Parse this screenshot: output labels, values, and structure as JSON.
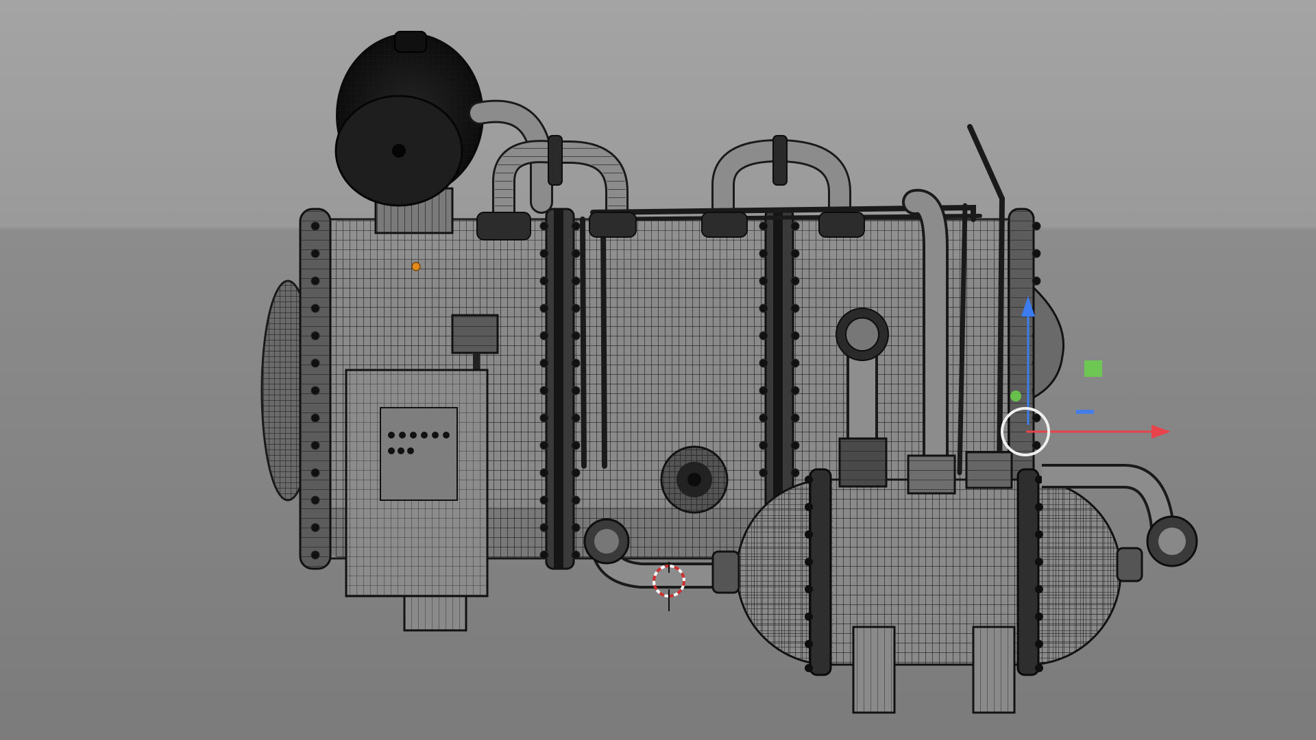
{
  "viewport": {
    "mode": "wireframe-on-shaded",
    "background_colors": {
      "upper": "#a4a4a4",
      "lower": "#7b7b7b"
    },
    "model_color": "#888888",
    "wire_color": "#1e1e1e"
  },
  "gizmo": {
    "x_axis_color": "#e8424a",
    "y_axis_color": "#6bd24a",
    "z_axis_color": "#3c7cf0",
    "handle_color": "#f0f0f0"
  },
  "cursor_3d": {
    "icon": "3d-cursor-icon",
    "colors": [
      "#d23030",
      "#ffffff"
    ]
  },
  "origin_marker": {
    "icon": "origin-dot-icon",
    "color": "#e08a1c"
  }
}
